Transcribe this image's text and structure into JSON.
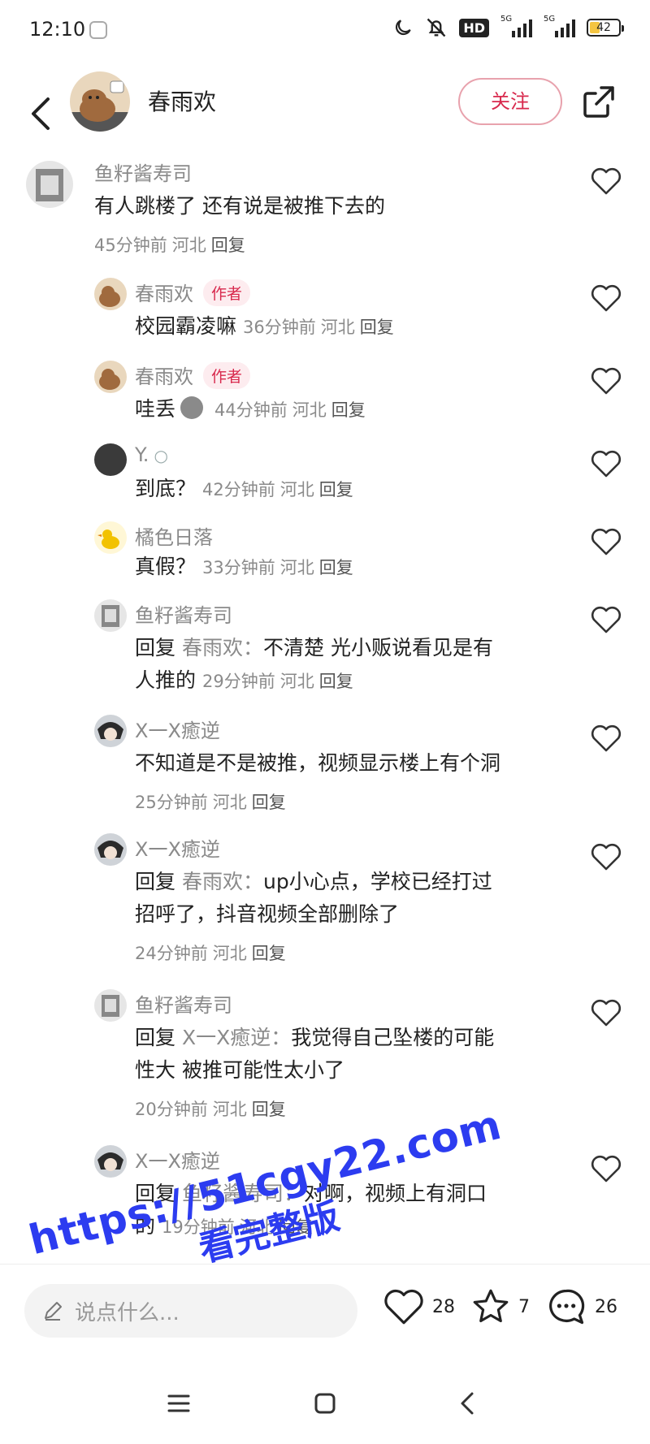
{
  "status": {
    "time": "12:10",
    "hd": "HD",
    "net1": "5G",
    "net2": "5G",
    "battery": "42",
    "battery_level": 0.42,
    "icons": [
      "moon-icon",
      "bell-off-icon"
    ]
  },
  "header": {
    "name": "春雨欢",
    "follow_label": "关注"
  },
  "comments": [
    {
      "user": "鱼籽酱寿司",
      "text": "有人跳楼了 还有说是被推下去的",
      "time": "45分钟前",
      "location": "河北",
      "reply": "回复"
    },
    {
      "user": "春雨欢",
      "tag": "作者",
      "text": "校园霸凌嘛",
      "time": "36分钟前",
      "location": "河北",
      "reply": "回复"
    },
    {
      "user": "春雨欢",
      "tag": "作者",
      "text": "哇丢",
      "time": "44分钟前",
      "location": "河北",
      "reply": "回复"
    },
    {
      "user": "Y.",
      "text": "到底？",
      "time": "42分钟前",
      "location": "河北",
      "reply": "回复"
    },
    {
      "user": "橘色日落",
      "text": "真假？",
      "time": "33分钟前",
      "location": "河北",
      "reply": "回复"
    },
    {
      "user": "鱼籽酱寿司",
      "reply_word": "回复",
      "reply_to": "春雨欢：",
      "text": "不清楚 光小贩说看见是有",
      "text2": "人推的",
      "time": "29分钟前",
      "location": "河北",
      "reply": "回复"
    },
    {
      "user": "X一X癒逆",
      "text": "不知道是不是被推，视频显示楼上有个洞",
      "time": "25分钟前",
      "location": "河北",
      "reply": "回复"
    },
    {
      "user": "X一X癒逆",
      "reply_word": "回复",
      "reply_to": "春雨欢：",
      "text": "up小心点，学校已经打过",
      "text2": "招呼了，抖音视频全部删除了",
      "time": "24分钟前",
      "location": "河北",
      "reply": "回复"
    },
    {
      "user": "鱼籽酱寿司",
      "reply_word": "回复",
      "reply_to": "X一X癒逆：",
      "text": "我觉得自己坠楼的可能",
      "text2": "性大 被推可能性太小了",
      "time": "20分钟前",
      "location": "河北",
      "reply": "回复"
    },
    {
      "user": "X一X癒逆",
      "reply_word": "回复",
      "reply_to": "鱼籽酱寿司：",
      "text": "对啊，视频上有洞口",
      "text2": "的",
      "time": "19分钟前",
      "location": "河北",
      "reply": "回复"
    }
  ],
  "bottom": {
    "placeholder": "说点什么...",
    "likes": "28",
    "stars": "7",
    "comments": "26"
  },
  "watermark": {
    "url": "https://51cgy22.com",
    "sub": "看完整版"
  },
  "colors": {
    "accent": "#d8294d",
    "watermark": "#2c3cf0",
    "muted": "#8a8a8a"
  }
}
